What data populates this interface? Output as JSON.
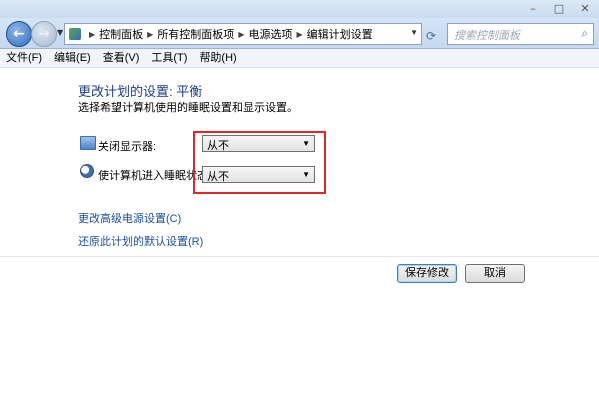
{
  "breadcrumb": {
    "items": [
      "控制面板",
      "所有控制面板项",
      "电源选项",
      "编辑计划设置"
    ],
    "separator": "▶"
  },
  "search": {
    "placeholder": "搜索控制面板"
  },
  "menu": [
    "文件(F)",
    "编辑(E)",
    "查看(V)",
    "工具(T)",
    "帮助(H)"
  ],
  "page": {
    "title": "更改计划的设置: 平衡",
    "subtitle": "选择希望计算机使用的睡眠设置和显示设置。"
  },
  "settings": [
    {
      "label": "关闭显示器:",
      "value": "从不",
      "icon": "monitor-icon"
    },
    {
      "label": "使计算机进入睡眠状态:",
      "value": "从不",
      "icon": "moon-icon"
    }
  ],
  "links": {
    "advanced": "更改高级电源设置(C)",
    "restore": "还原此计划的默认设置(R)"
  },
  "buttons": {
    "save": "保存修改",
    "cancel": "取消"
  },
  "colors": {
    "highlight": "#e0262b",
    "title": "#1e3d8a",
    "link": "#1a4fa0"
  }
}
